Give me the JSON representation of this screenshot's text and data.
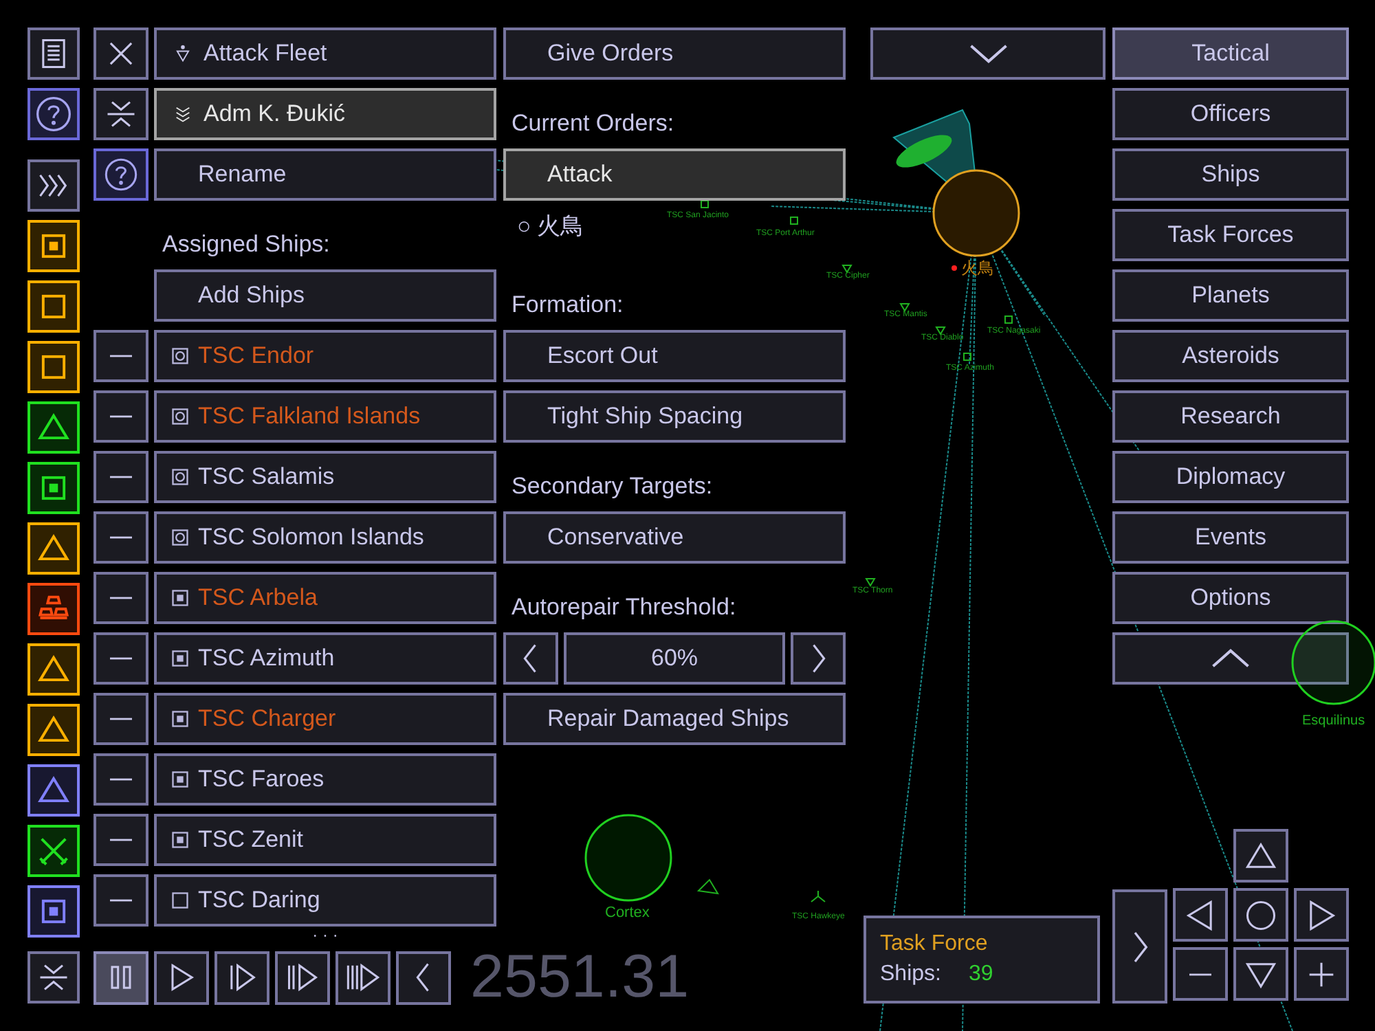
{
  "sidebar": {
    "items": [
      {
        "kind": "square-dot",
        "color": "#ffb000"
      },
      {
        "kind": "square",
        "color": "#ffb000"
      },
      {
        "kind": "square",
        "color": "#ffb000"
      },
      {
        "kind": "triangle",
        "color": "#20e020"
      },
      {
        "kind": "square-dot",
        "color": "#20e020"
      },
      {
        "kind": "triangle",
        "color": "#ffb000"
      },
      {
        "kind": "bars",
        "color": "#ff4a10"
      },
      {
        "kind": "triangle",
        "color": "#ffb000"
      },
      {
        "kind": "triangle",
        "color": "#ffb000"
      },
      {
        "kind": "triangle",
        "color": "#8080ff"
      },
      {
        "kind": "swords",
        "color": "#20e020"
      },
      {
        "kind": "square-dot",
        "color": "#8080ff"
      }
    ]
  },
  "fleet": {
    "title": "Attack Fleet",
    "commander": {
      "name": "Adm K. Đukić",
      "selected": true
    },
    "rename_button": "Rename",
    "assigned_label": "Assigned Ships:",
    "add_button": "Add Ships",
    "ships": [
      {
        "name": "TSC Endor",
        "kind": "target",
        "color": "#d4581c"
      },
      {
        "name": "TSC Falkland Islands",
        "kind": "target",
        "color": "#d4581c"
      },
      {
        "name": "TSC Salamis",
        "kind": "target",
        "color": "#c9c7ea"
      },
      {
        "name": "TSC Solomon Islands",
        "kind": "target",
        "color": "#c9c7ea"
      },
      {
        "name": "TSC Arbela",
        "kind": "dot",
        "color": "#d4581c"
      },
      {
        "name": "TSC Azimuth",
        "kind": "dot",
        "color": "#c9c7ea"
      },
      {
        "name": "TSC Charger",
        "kind": "dot",
        "color": "#d4581c"
      },
      {
        "name": "TSC Faroes",
        "kind": "dot",
        "color": "#c9c7ea"
      },
      {
        "name": "TSC Zenit",
        "kind": "dot",
        "color": "#c9c7ea"
      },
      {
        "name": "TSC Daring",
        "kind": "empty",
        "color": "#c9c7ea"
      }
    ],
    "more": "· · ·"
  },
  "orders": {
    "give_button": "Give Orders",
    "current_label": "Current Orders:",
    "current": {
      "label": "Attack",
      "selected": true
    },
    "target_symbol": "○",
    "target_name": "火鳥",
    "formation_label": "Formation:",
    "formation": [
      "Escort Out",
      "Tight Ship Spacing"
    ],
    "secondary_label": "Secondary Targets:",
    "secondary": "Conservative",
    "autorepair_label": "Autorepair Threshold:",
    "autorepair_value": "60%",
    "repair_button": "Repair Damaged Ships"
  },
  "nav": [
    {
      "label": "Tactical",
      "selected": true
    },
    {
      "label": "Officers",
      "selected": false
    },
    {
      "label": "Ships",
      "selected": false
    },
    {
      "label": "Task Forces",
      "selected": false
    },
    {
      "label": "Planets",
      "selected": false
    },
    {
      "label": "Asteroids",
      "selected": false
    },
    {
      "label": "Research",
      "selected": false
    },
    {
      "label": "Diplomacy",
      "selected": false
    },
    {
      "label": "Events",
      "selected": false
    },
    {
      "label": "Options",
      "selected": false
    }
  ],
  "playback": [
    {
      "kind": "pause",
      "selected": true
    },
    {
      "kind": "play",
      "selected": false
    },
    {
      "kind": "fast1",
      "selected": false
    },
    {
      "kind": "fast2",
      "selected": false
    },
    {
      "kind": "fast3",
      "selected": false
    },
    {
      "kind": "back",
      "selected": false
    }
  ],
  "clock": "2551.31",
  "task_force_panel": {
    "title": "Task Force",
    "ships_label": "Ships:",
    "ships_count": "39"
  },
  "map": {
    "labels": [
      {
        "text": "火鳥",
        "color": "#c08010"
      },
      {
        "text": "TSC San Jacinto",
        "color": "#20a020"
      },
      {
        "text": "TSC Port Arthur",
        "color": "#20a020"
      },
      {
        "text": "TSC Cipher",
        "color": "#20a020"
      },
      {
        "text": "TSC Mantis",
        "color": "#20a020"
      },
      {
        "text": "TSC Diablo",
        "color": "#20a020"
      },
      {
        "text": "TSC Azimuth",
        "color": "#20a020"
      },
      {
        "text": "TSC Nagasaki",
        "color": "#20a020"
      },
      {
        "text": "TSC Thorn",
        "color": "#20a020"
      },
      {
        "text": "Cortex",
        "color": "#20b020"
      },
      {
        "text": "TSC Hawkeye",
        "color": "#20a020"
      },
      {
        "text": "Esquilinus",
        "color": "#20b020"
      }
    ]
  }
}
